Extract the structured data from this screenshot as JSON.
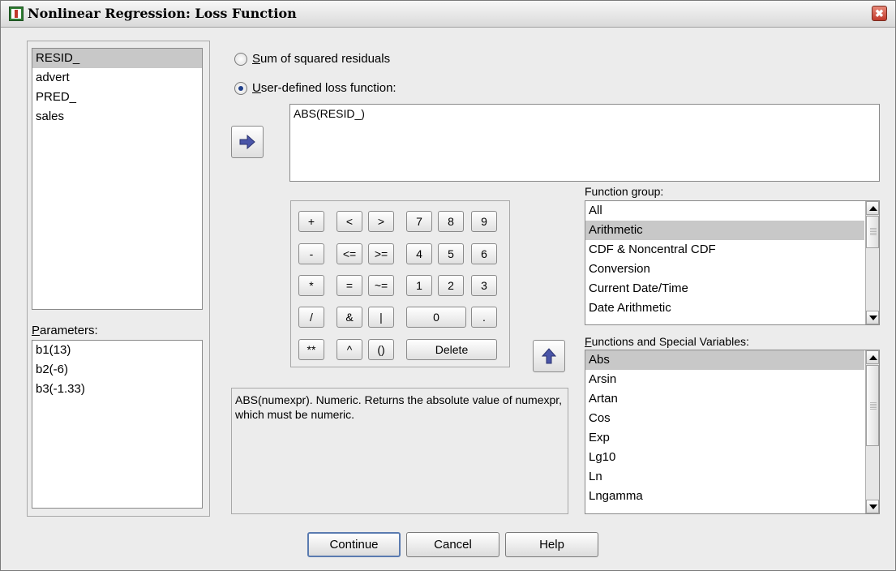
{
  "window": {
    "title": "Nonlinear Regression: Loss Function",
    "close_glyph": "✖"
  },
  "variables": {
    "items": [
      "RESID_",
      "advert",
      "PRED_",
      "sales"
    ],
    "selected": "RESID_"
  },
  "parameters": {
    "label_mnemonic": "P",
    "label_rest": "arameters:",
    "items": [
      "b1(13)",
      "b2(-6)",
      "b3(-1.33)"
    ]
  },
  "radio": {
    "sum": {
      "mnemonic": "S",
      "rest": "um of squared residuals",
      "checked": false
    },
    "user": {
      "mnemonic": "U",
      "rest": "ser-defined loss function:",
      "checked": true
    }
  },
  "expression": {
    "value": "ABS(RESID_)"
  },
  "keypad": {
    "row1": [
      "+",
      "<",
      ">",
      "7",
      "8",
      "9"
    ],
    "row2": [
      "-",
      "<=",
      ">=",
      "4",
      "5",
      "6"
    ],
    "row3": [
      "*",
      "=",
      "~=",
      "1",
      "2",
      "3"
    ],
    "row4": [
      "/",
      "&",
      "|",
      "0",
      "."
    ],
    "row5": [
      "**",
      "^",
      "()",
      "Delete"
    ]
  },
  "function_group": {
    "label_before": "Function ",
    "mnemonic": "g",
    "label_after": "roup:",
    "items": [
      "All",
      "Arithmetic",
      "CDF & Noncentral CDF",
      "Conversion",
      "Current Date/Time",
      "Date Arithmetic"
    ],
    "selected": "Arithmetic"
  },
  "functions": {
    "mnemonic": "F",
    "label_rest": "unctions and Special Variables:",
    "items": [
      "Abs",
      "Arsin",
      "Artan",
      "Cos",
      "Exp",
      "Lg10",
      "Ln",
      "Lngamma"
    ],
    "selected": "Abs"
  },
  "description": "ABS(numexpr). Numeric. Returns the absolute value of numexpr, which must be numeric.",
  "buttons": {
    "continue": "Continue",
    "cancel": "Cancel",
    "help": "Help"
  },
  "colors": {
    "selection": "#c8c8c8",
    "arrow_icon": "#4a55a8",
    "radio_dot": "#1f3f8a",
    "close_button": "#c0392b"
  }
}
